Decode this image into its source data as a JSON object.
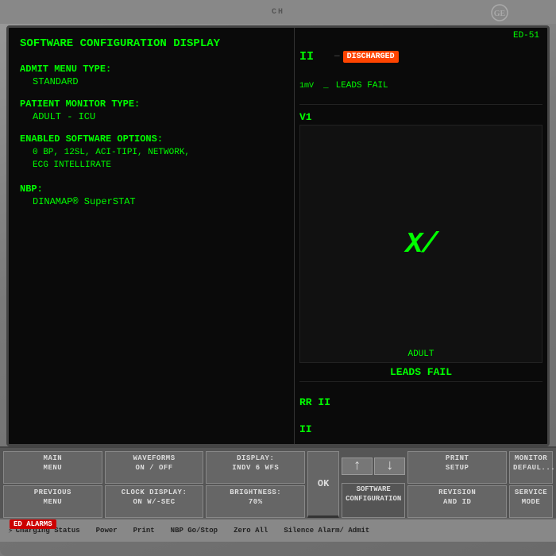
{
  "monitor": {
    "title": "SOFTWARE CONFIGURATION DISPLAY",
    "admit_menu_label": "ADMIT MENU TYPE:",
    "admit_menu_value": "STANDARD",
    "patient_monitor_label": "PATIENT MONITOR TYPE:",
    "patient_monitor_value": "ADULT - ICU",
    "enabled_options_label": "ENABLED SOFTWARE OPTIONS:",
    "enabled_options_value": "0 BP, 12SL, ACI-TIPI, NETWORK,\n      ECG INTELLIRATE",
    "enabled_options_line1": "0 BP, 12SL, ACI-TIPI, NETWORK,",
    "enabled_options_line2": "ECG INTELLIRATE",
    "nbp_label": "NBP:",
    "nbp_value": "DINAMAP® SuperSTAT",
    "ed_label": "ED-51",
    "discharged_text": "DISCHARGED",
    "leads_fail_text": "LEADS FAIL",
    "channel_ii": "II",
    "channel_1mv": "1mV",
    "channel_v1": "V1",
    "channel_rr": "RR II",
    "channel_ii2": "II",
    "adult_label": "ADULT",
    "leads_fail_large": "LEADS FAIL",
    "dash": "—",
    "underscore": "_"
  },
  "toolbar": {
    "main_menu": "MAIN\nMENU",
    "waveforms": "WAVEFORMS\nON / OFF",
    "display": "DISPLAY:\nINDV 6 WFS",
    "previous_menu": "PREVIOUS\nMENU",
    "clock_display": "CLOCK DISPLAY:\nON W/-SEC",
    "brightness": "BRIGHTNESS:\n70%",
    "ok": "OK",
    "arrow_up": "↑",
    "arrow_down": "↓",
    "software_config": "SOFTWARE\nCONFIGURATION",
    "print_setup": "PRINT\nSETUP",
    "revision_and_id": "REVISION\nAND ID",
    "monitor_default": "MONITOR\nDEFAULT",
    "service_mode": "SERVICE\nMODE"
  },
  "status_bar": {
    "charging_status": "Charging Status",
    "power": "Power",
    "print": "Print",
    "nbp_go_stop": "NBP Go/Stop",
    "zero_all": "Zero All",
    "silence_alarm": "Silence Alarm/\nAdmit",
    "ed_alarms": "ED ALARMS"
  },
  "colors": {
    "green": "#00ff00",
    "red_badge": "#ff4400",
    "screen_bg": "#0a0a0a"
  }
}
